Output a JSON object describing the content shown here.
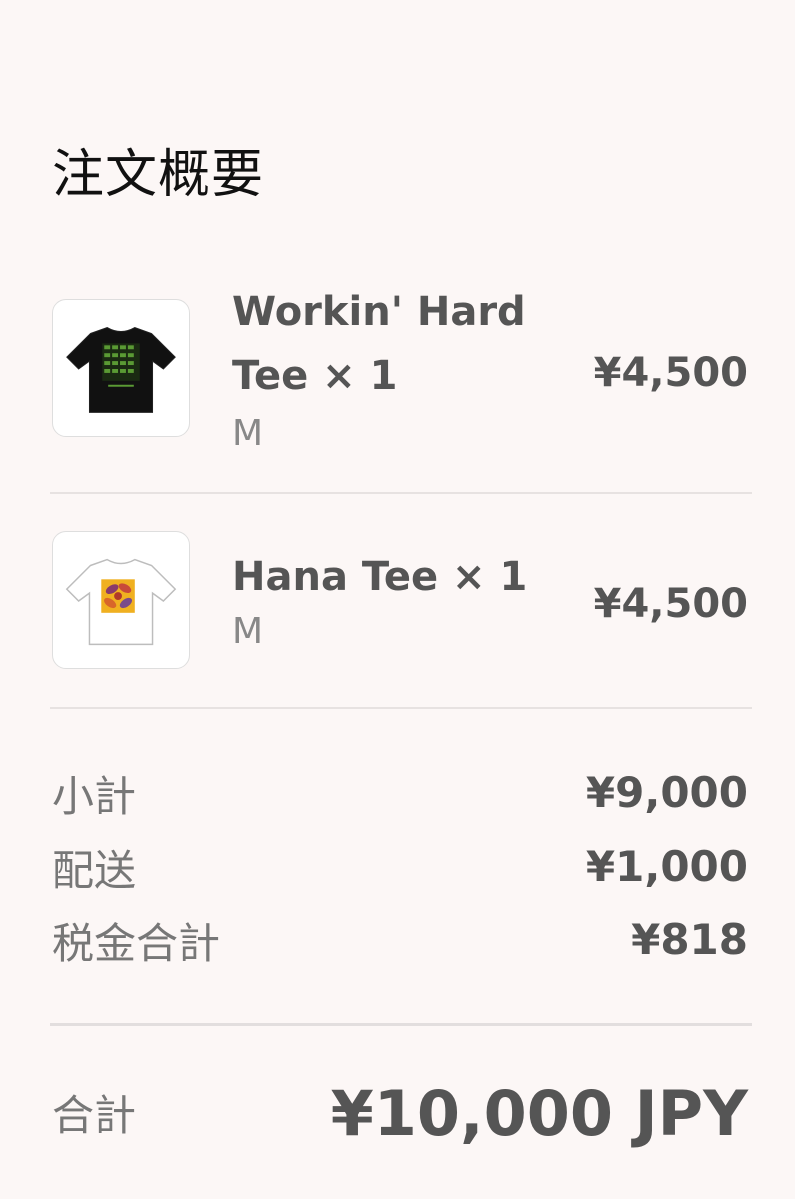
{
  "summary": {
    "title": "注文概要"
  },
  "items": [
    {
      "name": "Workin' Hard Tee × 1",
      "name_line1": "Workin' Hard",
      "name_line2": "Tee × 1",
      "variant": "M",
      "price": "¥4,500",
      "thumbnail_icon": "black-tshirt-icon",
      "tee_color": "#111111",
      "print_color": "#4a8a2c"
    },
    {
      "name": "Hana Tee × 1",
      "variant": "M",
      "price": "¥4,500",
      "thumbnail_icon": "white-tshirt-icon",
      "tee_color": "#ffffff",
      "print_color": "#e8a21a"
    }
  ],
  "totals": {
    "subtotal_label": "小計",
    "subtotal_value": "¥9,000",
    "shipping_label": "配送",
    "shipping_value": "¥1,000",
    "tax_label": "税金合計",
    "tax_value": "¥818",
    "total_label": "合計",
    "total_value": "¥10,000 JPY"
  }
}
